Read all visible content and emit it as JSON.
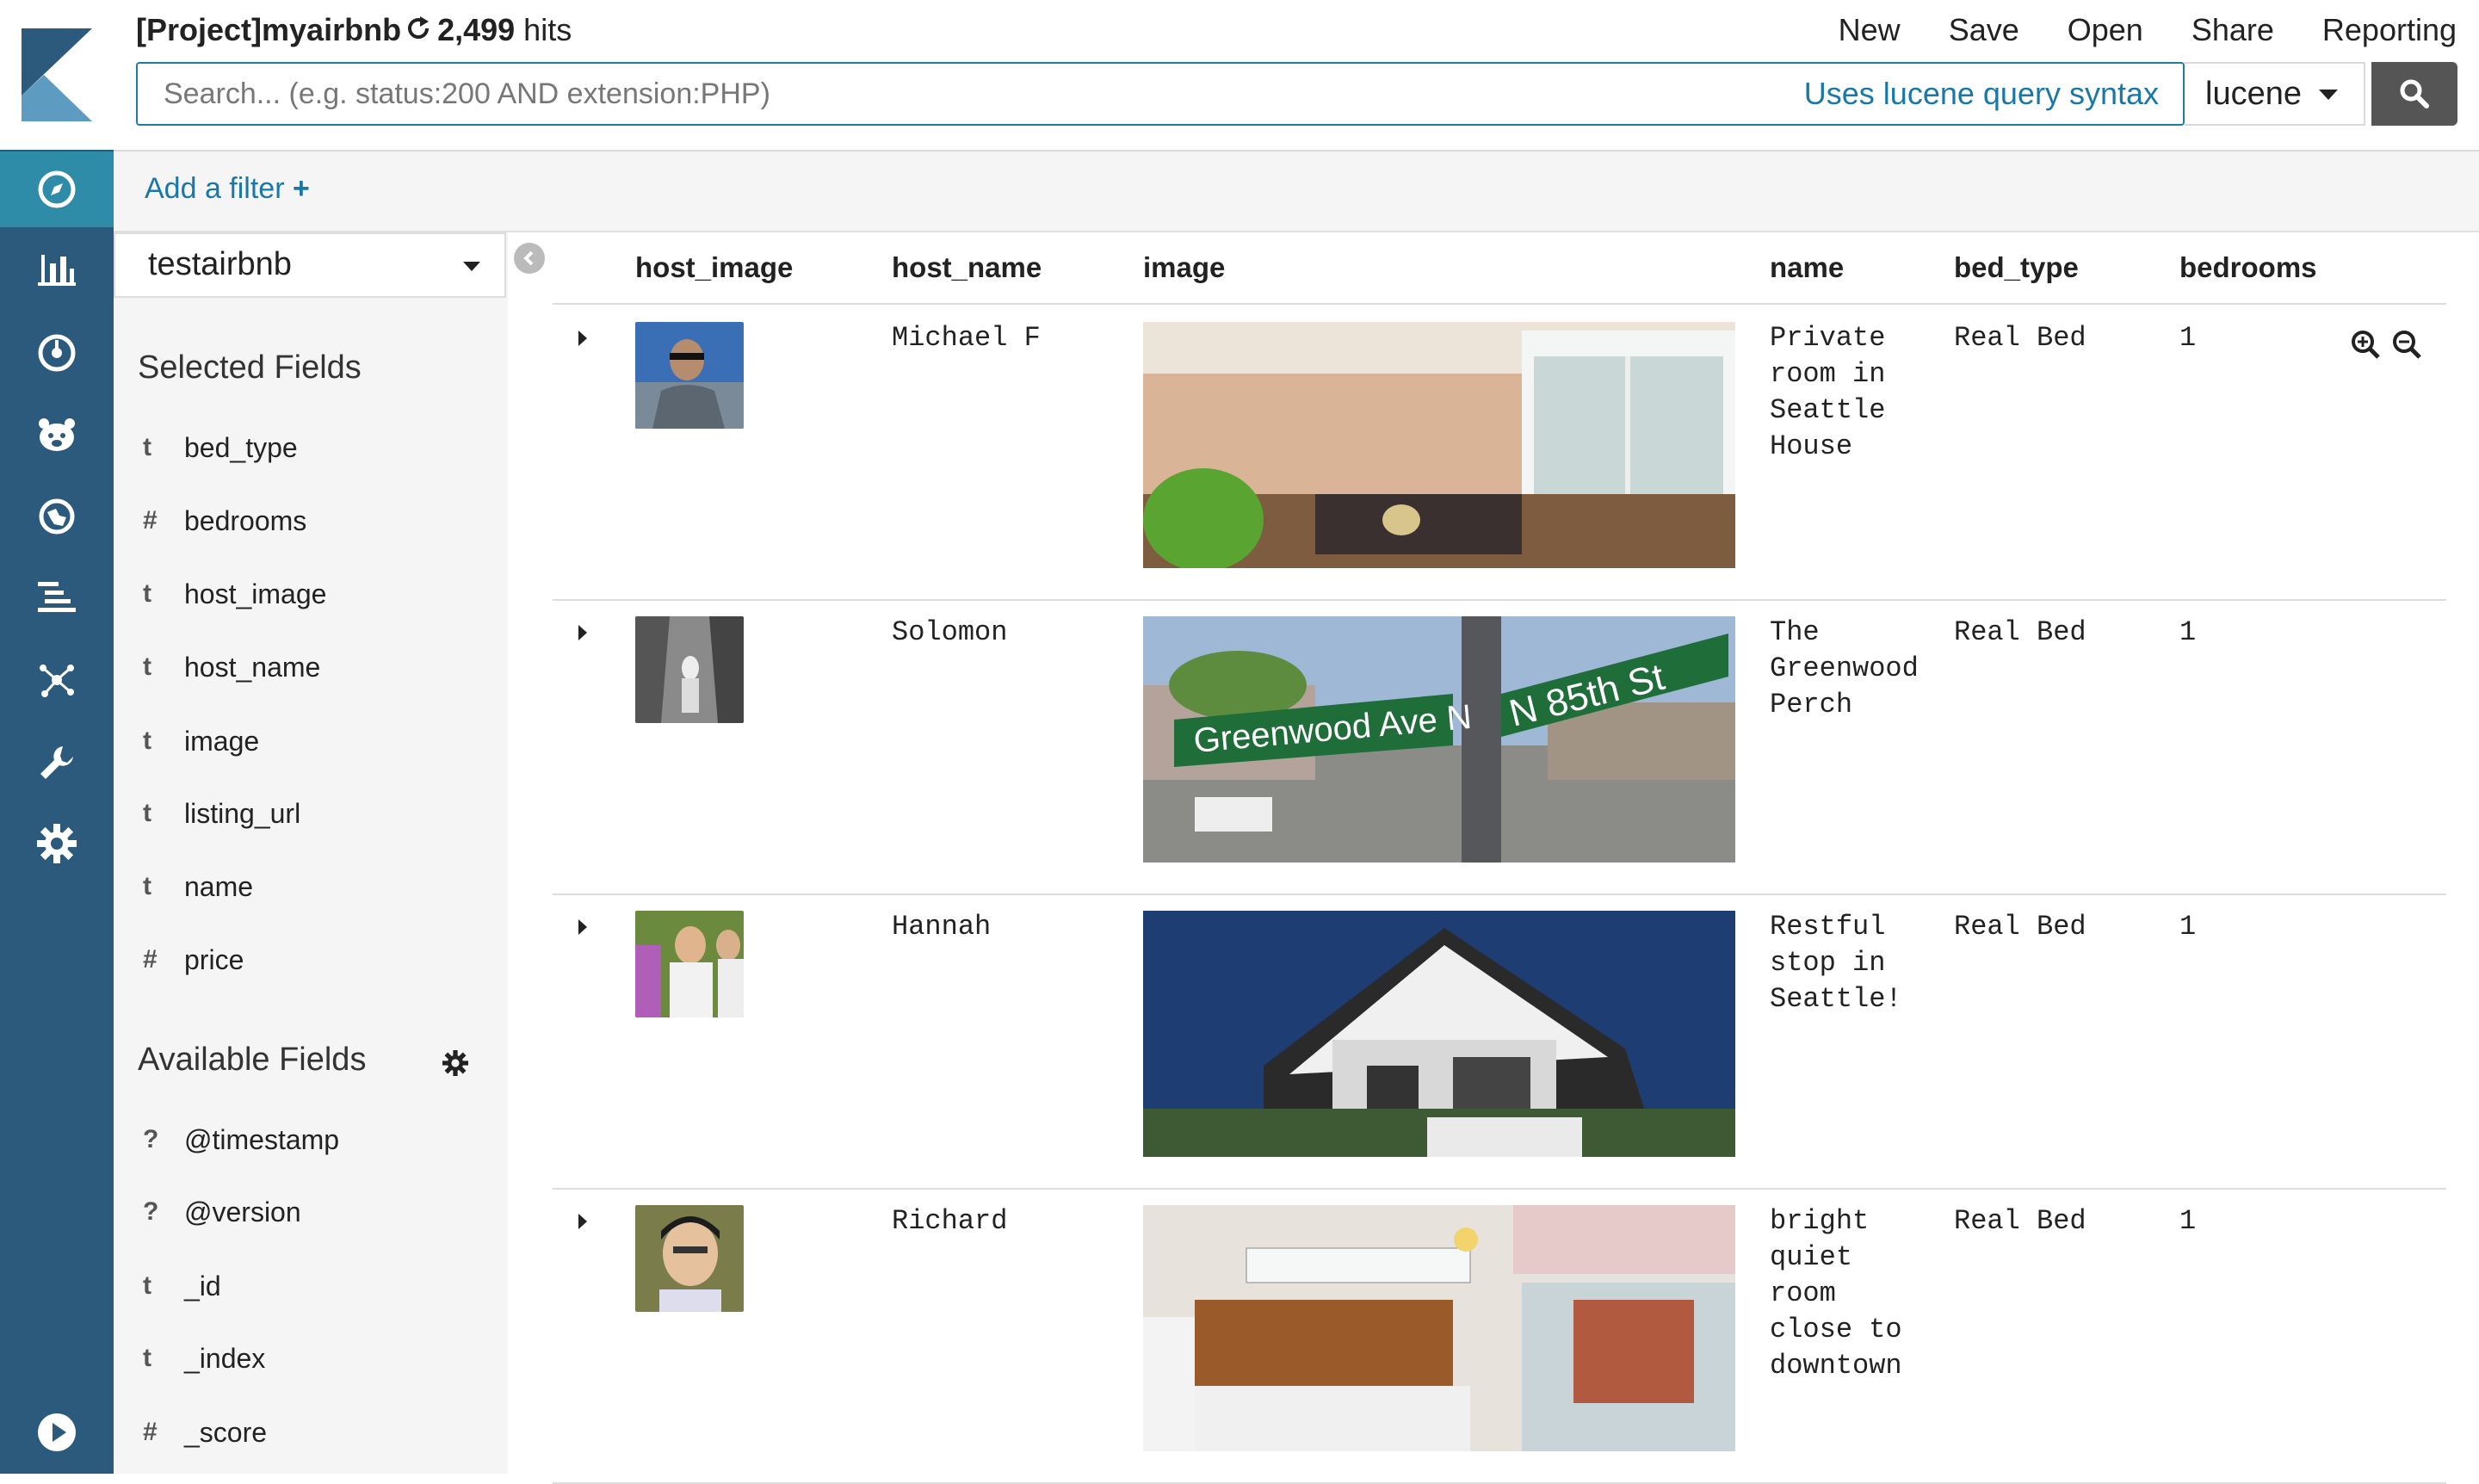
{
  "header": {
    "project_title": "[Project]myairbnb",
    "hits_count": "2,499",
    "hits_label": "hits",
    "menu": [
      "New",
      "Save",
      "Open",
      "Share",
      "Reporting"
    ]
  },
  "search": {
    "placeholder": "Search... (e.g. status:200 AND extension:PHP)",
    "syntax_hint": "Uses lucene query syntax",
    "language": "lucene"
  },
  "filter": {
    "add_label": "Add a filter"
  },
  "sidebar": {
    "index_pattern": "testairbnb",
    "selected_title": "Selected Fields",
    "selected_fields": [
      {
        "type": "t",
        "name": "bed_type"
      },
      {
        "type": "#",
        "name": "bedrooms"
      },
      {
        "type": "t",
        "name": "host_image"
      },
      {
        "type": "t",
        "name": "host_name"
      },
      {
        "type": "t",
        "name": "image"
      },
      {
        "type": "t",
        "name": "listing_url"
      },
      {
        "type": "t",
        "name": "name"
      },
      {
        "type": "#",
        "name": "price"
      }
    ],
    "available_title": "Available Fields",
    "available_fields": [
      {
        "type": "?",
        "name": "@timestamp"
      },
      {
        "type": "?",
        "name": "@version"
      },
      {
        "type": "t",
        "name": "_id"
      },
      {
        "type": "t",
        "name": "_index"
      },
      {
        "type": "#",
        "name": "_score"
      }
    ]
  },
  "table": {
    "columns": [
      "host_image",
      "host_name",
      "image",
      "name",
      "bed_type",
      "bedrooms"
    ],
    "rows": [
      {
        "host_name": "Michael F",
        "name_lines": [
          "Private",
          "room in",
          "Seattle",
          "House"
        ],
        "bed_type": "Real Bed",
        "bedrooms": "1"
      },
      {
        "host_name": "Solomon",
        "name_lines": [
          "The",
          "Greenwood",
          "Perch"
        ],
        "bed_type": "Real Bed",
        "bedrooms": "1"
      },
      {
        "host_name": "Hannah",
        "name_lines": [
          "Restful",
          "stop in",
          "Seattle!"
        ],
        "bed_type": "Real Bed",
        "bedrooms": "1"
      },
      {
        "host_name": "Richard",
        "name_lines": [
          "bright",
          "quiet",
          "room",
          "close to",
          "downtown"
        ],
        "bed_type": "Real Bed",
        "bedrooms": "1"
      }
    ]
  },
  "photo_signs": {
    "street_a": "Greenwood Ave N",
    "street_b": "N 85th St"
  },
  "colors": {
    "nav_bg": "#2b5a7c",
    "accent": "#1a78a6",
    "active_nav": "#2e8ca8"
  },
  "icons": [
    "kibana-logo",
    "discover-icon",
    "visualize-icon",
    "dashboard-icon",
    "canvas-icon",
    "maps-icon",
    "logs-icon",
    "graph-icon",
    "devtools-icon",
    "management-icon",
    "play-icon",
    "refresh-icon",
    "search-icon",
    "gear-icon",
    "zoom-in-icon",
    "zoom-out-icon"
  ]
}
